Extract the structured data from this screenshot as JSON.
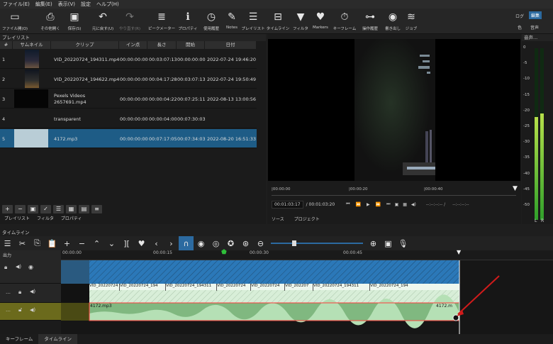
{
  "menu": [
    "ファイル(E)",
    "編集(E)",
    "表示(V)",
    "設定",
    "ヘルプ(H)"
  ],
  "toolbar": [
    {
      "label": "ファイル開(O)",
      "icon": "folder-open-icon",
      "glyph": "▭"
    },
    {
      "label": "その他開く",
      "icon": "open-other-icon",
      "glyph": "⎙"
    },
    {
      "label": "保存(S)",
      "icon": "save-icon",
      "glyph": "💾"
    },
    {
      "label": "元に戻す(U)",
      "icon": "undo-icon",
      "glyph": "↶"
    },
    {
      "label": "やり直す(R)",
      "icon": "redo-icon",
      "glyph": "↷"
    },
    {
      "label": "ピークメーター",
      "icon": "peak-meter-icon",
      "glyph": "≣"
    },
    {
      "label": "プロパティ",
      "icon": "info-icon",
      "glyph": "ℹ"
    },
    {
      "label": "使用履歴",
      "icon": "history-icon",
      "glyph": "◷"
    },
    {
      "label": "Notes",
      "icon": "notes-icon",
      "glyph": "✎"
    },
    {
      "label": "プレイリスト",
      "icon": "playlist-icon",
      "glyph": "☰"
    },
    {
      "label": "タイムライン",
      "icon": "timeline-icon",
      "glyph": "⊟"
    },
    {
      "label": "フィルタ",
      "icon": "filter-icon",
      "glyph": "▼"
    },
    {
      "label": "Markers",
      "icon": "marker-icon",
      "glyph": "♥"
    },
    {
      "label": "キーフレーム",
      "icon": "keyframe-icon",
      "glyph": "⏱"
    },
    {
      "label": "操作履歴",
      "icon": "jobs-history-icon",
      "glyph": "⊶"
    },
    {
      "label": "書き出し",
      "icon": "export-icon",
      "glyph": "◉"
    },
    {
      "label": "ジョブ",
      "icon": "jobs-icon",
      "glyph": "≋"
    }
  ],
  "layout_buttons": {
    "log": "ログ",
    "edit": "編集",
    "color": "色",
    "audio": "音声"
  },
  "playlist": {
    "title": "プレイリスト",
    "columns": [
      "#",
      "サムネイル",
      "クリップ",
      "イン点",
      "長さ",
      "開始",
      "日付"
    ],
    "rows": [
      {
        "num": "1",
        "clip": "VID_20220724_194311.mp4",
        "in": "00:00:00:00",
        "len": "00:03:07:13",
        "start": "00:00:00:00",
        "date": "2022-07-24 19:46:20",
        "selected": false
      },
      {
        "num": "2",
        "clip": "VID_20220724_194622.mp4",
        "in": "00:00:00:00",
        "len": "00:04:17:28",
        "start": "00:03:07:13",
        "date": "2022-07-24 19:50:49",
        "selected": false
      },
      {
        "num": "3",
        "clip": "Pexels Videos 2657691.mp4",
        "in": "00:00:00:00",
        "len": "00:00:04:22",
        "start": "00:07:25:11",
        "date": "2022-08-13 13:00:56",
        "selected": false
      },
      {
        "num": "4",
        "clip": "transparent",
        "in": "00:00:00:00",
        "len": "00:00:04:00",
        "start": "00:07:30:03",
        "date": "",
        "selected": false
      },
      {
        "num": "5",
        "clip": "4172.mp3",
        "in": "00:00:00:00",
        "len": "00:07:17:05",
        "start": "00:07:34:03",
        "date": "2022-08-20 16:51:33",
        "selected": true
      }
    ],
    "tabs": [
      "プレイリスト",
      "フィルタ",
      "プロパティ"
    ]
  },
  "player": {
    "ruler_ticks": [
      "|00:00:00",
      "|00:00:20",
      "|00:00:40"
    ],
    "current_time": "00:01:03:17",
    "total_time": "/ 00:01:03:20",
    "in_point": "--:--:--:-- /",
    "out_point": "--:--:--:--",
    "tabs": [
      "ソース",
      "プロジェクト"
    ]
  },
  "meter": {
    "title": "音声...",
    "scale": [
      "0",
      "-5",
      "-10",
      "-15",
      "-20",
      "-25",
      "-30",
      "-35",
      "-40",
      "-45",
      "-50"
    ],
    "left_label": "L",
    "right_label": "R",
    "level_left": 0.6,
    "level_right": 0.62
  },
  "timeline": {
    "title": "タイムライン",
    "output_label": "出力",
    "ticks": [
      "00:00:00",
      "00:00:15",
      "00:00:30",
      "00:00:45"
    ],
    "v1_clips": [
      "VID_20220724",
      "VID_20220724_194",
      "VID_20220724_194311",
      "VID_20220724",
      "VID_20220724",
      "VID_202207",
      "VID_20220724_194311",
      "VID_20220724_194"
    ],
    "audio_label_start": "4172.mp3",
    "audio_label_end": "4172.m"
  },
  "bottom_tabs": [
    "キーフレーム",
    "タイムライン"
  ]
}
